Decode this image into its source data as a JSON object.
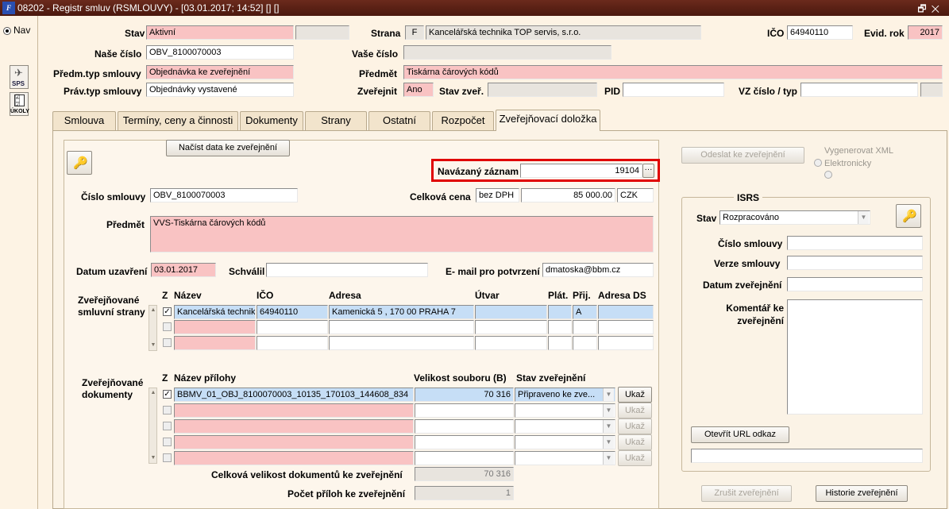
{
  "window": {
    "title": "08202 - Registr smluv (RSMLOUVY) - [03.01.2017; 14:52] [] []",
    "app_icon_text": "F"
  },
  "leftbar": {
    "nav_label": "Nav",
    "sps_label": "SPS",
    "ukoly_label": "ÚKOLY"
  },
  "header": {
    "stav_label": "Stav",
    "stav_value": "Aktivní",
    "strana_label": "Strana",
    "strana_code": "F",
    "strana_name": "Kancelářská technika TOP servis, s.r.o.",
    "ico_label": "IČO",
    "ico_value": "64940110",
    "evid_rok_label": "Evid. rok",
    "evid_rok_value": "2017",
    "nase_cislo_label": "Naše číslo",
    "nase_cislo_value": "OBV_8100070003",
    "vase_cislo_label": "Vaše číslo",
    "vase_cislo_value": "",
    "predm_typ_label": "Předm.typ smlouvy",
    "predm_typ_value": "Objednávka ke zveřejnění",
    "predmet_label": "Předmět",
    "predmet_value": "Tiskárna čárových kódů",
    "prav_typ_label": "Práv.typ smlouvy",
    "prav_typ_value": "Objednávky vystavené",
    "zverejnit_label": "Zveřejnit",
    "zverejnit_value": "Ano",
    "stav_zver_label": "Stav zveř.",
    "stav_zver_value": "",
    "pid_label": "PID",
    "pid_value": "",
    "vz_label": "VZ číslo / typ",
    "vz_value": ""
  },
  "tabs": [
    {
      "label": "Smlouva"
    },
    {
      "label": "Termíny, ceny a činnosti"
    },
    {
      "label": "Dokumenty"
    },
    {
      "label": "Strany"
    },
    {
      "label": "Ostatní"
    },
    {
      "label": "Rozpočet"
    },
    {
      "label": "Zveřejňovací doložka"
    }
  ],
  "main": {
    "load_button": "Načíst data ke zveřejnění",
    "navazany_label": "Navázaný záznam",
    "navazany_value": "19104",
    "ellipsis": "···",
    "cislo_smlouvy_label": "Číslo smlouvy",
    "cislo_smlouvy_value": "OBV_8100070003",
    "celkova_cena_label": "Celková cena",
    "cena_typ": "bez DPH",
    "cena_value": "85 000.00",
    "mena": "CZK",
    "predmet_label": "Předmět",
    "predmet_value": "VVS-Tiskárna čárových kódů",
    "datum_label": "Datum uzavření",
    "datum_value": "03.01.2017",
    "schvalil_label": "Schválil",
    "schvalil_value": "",
    "email_label": "E- mail pro potvrzení",
    "email_value": "dmatoska@bbm.cz",
    "strany_section_label": "Zveřejňované smluvní strany",
    "strany_headers": {
      "z": "Z",
      "nazev": "Název",
      "ico": "IČO",
      "adresa": "Adresa",
      "utvar": "Útvar",
      "plat": "Plát.",
      "prij": "Přij.",
      "adresa_ds": "Adresa DS"
    },
    "strany_rows": [
      {
        "nazev": "Kancelářská technika",
        "ico": "64940110",
        "adresa": "Kamenická 5 , 170 00 PRAHA 7",
        "utvar": "",
        "plat": "",
        "prij": "A",
        "adresa_ds": ""
      },
      {
        "nazev": "",
        "ico": "",
        "adresa": "",
        "utvar": "",
        "plat": "",
        "prij": "",
        "adresa_ds": ""
      },
      {
        "nazev": "",
        "ico": "",
        "adresa": "",
        "utvar": "",
        "plat": "",
        "prij": "",
        "adresa_ds": ""
      }
    ],
    "dokumenty_section_label": "Zveřejňované dokumenty",
    "dokumenty_headers": {
      "z": "Z",
      "nazev": "Název přílohy",
      "velikost": "Velikost souboru (B)",
      "stav": "Stav zveřejnění"
    },
    "dokumenty_rows": [
      {
        "nazev": "BBMV_01_OBJ_8100070003_10135_170103_144608_834",
        "velikost": "70 316",
        "stav": "Připraveno ke zve..."
      },
      {
        "nazev": "",
        "velikost": "",
        "stav": ""
      },
      {
        "nazev": "",
        "velikost": "",
        "stav": ""
      },
      {
        "nazev": "",
        "velikost": "",
        "stav": ""
      },
      {
        "nazev": "",
        "velikost": "",
        "stav": ""
      }
    ],
    "ukaz_label": "Ukaž",
    "celkova_velikost_label": "Celková velikost dokumentů ke zveřejnění",
    "celkova_velikost_value": "70 316",
    "pocet_priloh_label": "Počet příloh ke zveřejnění",
    "pocet_priloh_value": "1"
  },
  "right": {
    "odeslat_button": "Odeslat ke zveřejnění",
    "vygenerovat_label": "Vygenerovat XML",
    "elektronicky_label": "Elektronicky",
    "isrs_title": "ISRS",
    "stav_label": "Stav",
    "stav_value": "Rozpracováno",
    "cislo_smlouvy_label": "Číslo smlouvy",
    "cislo_smlouvy_value": "",
    "verze_label": "Verze smlouvy",
    "verze_value": "",
    "datum_zver_label": "Datum zveřejnění",
    "datum_zver_value": "",
    "komentar_label": "Komentář ke zveřejnění",
    "komentar_value": "",
    "otevrit_url_button": "Otevřít URL odkaz",
    "url_value": "",
    "zrusit_button": "Zrušit zveřejnění",
    "historie_button": "Historie zveřejnění"
  },
  "colors": {
    "required": "#f9c3c3",
    "selected_row": "#c6def6",
    "highlight": "#e00000",
    "titlebar": "#5a1f14"
  }
}
